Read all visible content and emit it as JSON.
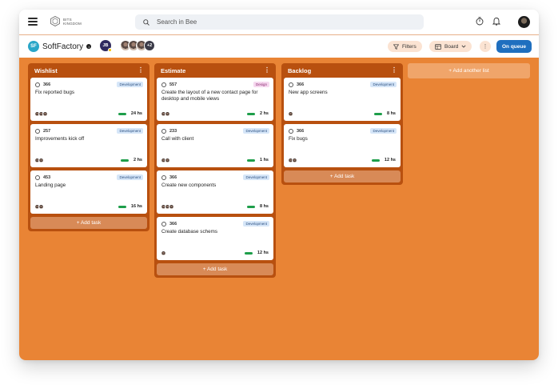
{
  "topbar": {
    "logo_text": "BITS\nKINGDOM",
    "search_placeholder": "Search in Bee"
  },
  "project": {
    "badge": "SF",
    "name": "SoftFactory",
    "info": "i"
  },
  "members": {
    "initials": "JB",
    "more_count": "+2"
  },
  "toolbar": {
    "filters_label": "Filters",
    "board_label": "Board",
    "more_label": "⋮",
    "queue_label": "On queue"
  },
  "lists": [
    {
      "title": "Wishlist",
      "cards": [
        {
          "id": "366",
          "tag": "Development",
          "title": "Fix reported bugs",
          "time": "24 hs"
        },
        {
          "id": "257",
          "tag": "Development",
          "title": "Improvements kick off",
          "time": "2 hs"
        },
        {
          "id": "453",
          "tag": "Development",
          "title": "Landing page",
          "time": "16 hs"
        }
      ],
      "add_label": "+ Add task"
    },
    {
      "title": "Estimate",
      "cards": [
        {
          "id": "557",
          "tag": "Design",
          "title": "Create the layout of a new contact page for desktop and mobile views",
          "time": "2 hs"
        },
        {
          "id": "233",
          "tag": "Development",
          "title": "Call with client",
          "time": "1 hs"
        },
        {
          "id": "366",
          "tag": "Development",
          "title": "Create new components",
          "time": "8 hs"
        },
        {
          "id": "366",
          "tag": "Development",
          "title": "Create database schems",
          "time": "12 hs"
        }
      ],
      "add_label": "+ Add task"
    },
    {
      "title": "Backlog",
      "cards": [
        {
          "id": "366",
          "tag": "Development",
          "title": "New app screens",
          "time": "8 hs"
        },
        {
          "id": "366",
          "tag": "Development",
          "title": "Fix bugs",
          "time": "12 hs"
        }
      ],
      "add_label": "+ Add task"
    }
  ],
  "add_list_label": "+ Add another list",
  "colors": {
    "canvas": "#e98435",
    "list": "#b8500f",
    "accent_blue": "#1f6fbf",
    "progress": "#1e9e4a"
  }
}
